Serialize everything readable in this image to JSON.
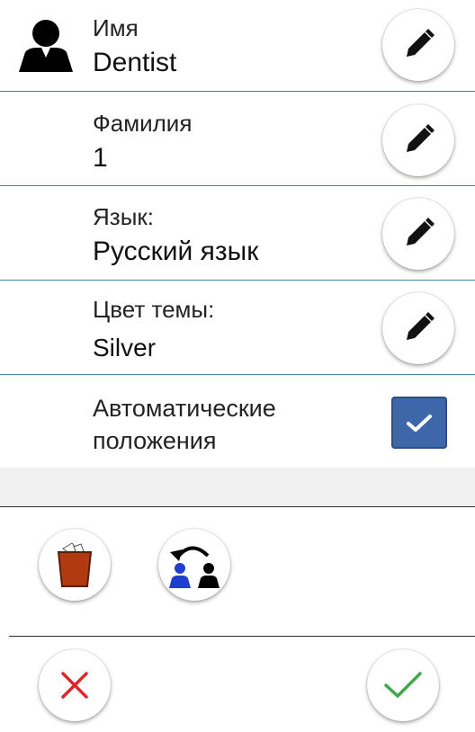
{
  "profile": {
    "first_name_label": "Имя",
    "first_name_value": "Dentist",
    "last_name_label": "Фамилия",
    "last_name_value": "1",
    "language_label": "Язык:",
    "language_value": "Русский язык",
    "theme_label": "Цвет темы:",
    "theme_value": "Silver",
    "auto_positions_label_line1": "Автоматические",
    "auto_positions_label_line2": "положения",
    "auto_positions_checked": true
  },
  "icons": {
    "user": "user-silhouette-icon",
    "edit": "pencil-icon",
    "trash": "trash-bin-icon",
    "switch_user": "switch-user-icon",
    "cancel": "close-x-icon",
    "confirm": "check-icon"
  },
  "colors": {
    "divider": "#3f86a8",
    "checkbox": "#3d67a9",
    "cancel": "#e0262b",
    "confirm": "#3ea84a",
    "trash": "#b23a12"
  }
}
